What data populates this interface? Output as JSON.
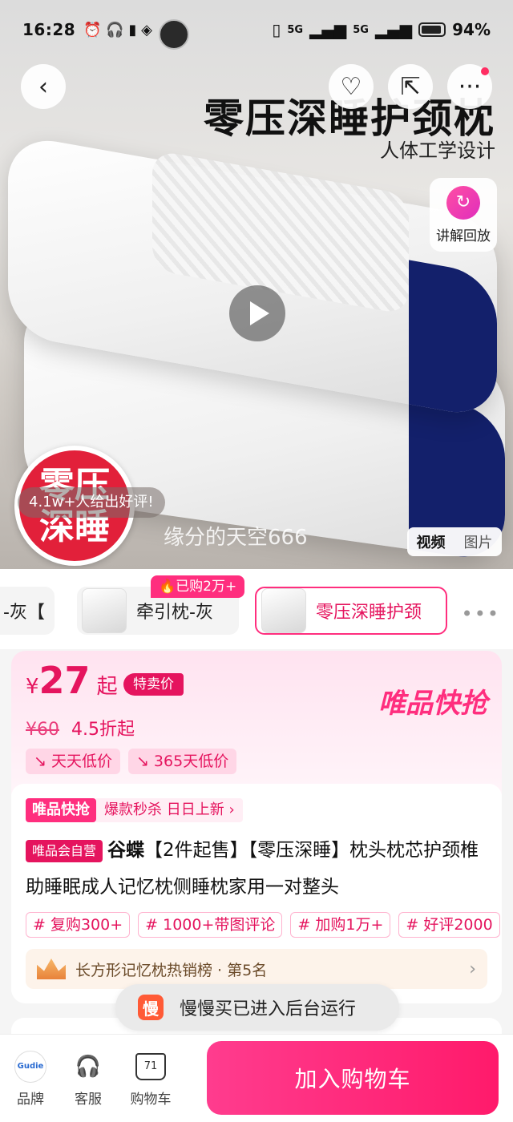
{
  "status_bar": {
    "time": "16:28",
    "left_icons": "⏰ 🎧 ▮ ◈",
    "network_1": "5G",
    "network_2": "5G",
    "battery": "94%"
  },
  "hero": {
    "title": "零压深睡护颈枕",
    "subtitle": "人体工学设计",
    "badge_line1": "零压",
    "badge_line2": "深睡",
    "review_bubble": "4.1w+人给出好评!",
    "review_user": "缘分的天空666",
    "replay_label": "讲解回放",
    "media_toggle": {
      "video": "视频",
      "image": "图片"
    }
  },
  "variants": {
    "items": [
      {
        "label": "-灰【"
      },
      {
        "label": "牵引枕-灰"
      },
      {
        "label": "零压深睡护颈"
      }
    ],
    "tag": "🔥已购2万+",
    "more": "•••"
  },
  "price": {
    "currency": "¥",
    "value": "27",
    "suffix": "起",
    "special_label": "特卖价",
    "brand_flash": "唯品快抢",
    "original": "¥60",
    "discount": "4.5折起",
    "low_tags": [
      "↘ 天天低价",
      "↘ 365天低价"
    ]
  },
  "detail": {
    "promo_badge": "唯品快抢",
    "promo_text": "爆款秒杀 日日上新 ›",
    "self_badge": "唯品会自营",
    "brand": "谷蝶",
    "title": "【2件起售】【零压深睡】枕头枕芯护颈椎助睡眠成人记忆枕侧睡枕家用一对整头",
    "hashtags": [
      "# 复购300+",
      "# 1000+带图评论",
      "# 加购1万+",
      "# 好评2000"
    ],
    "rank_text": "长方形记忆枕热销榜 · 第5名",
    "rank_arrow": "›"
  },
  "toast": {
    "icon": "慢",
    "text": "慢慢买已进入后台运行"
  },
  "bottom_bar": {
    "brand_logo": "Gudie",
    "brand_label": "品牌",
    "service_label": "客服",
    "cart_label": "购物车",
    "cart_count": "71",
    "add_to_cart": "加入购物车"
  }
}
